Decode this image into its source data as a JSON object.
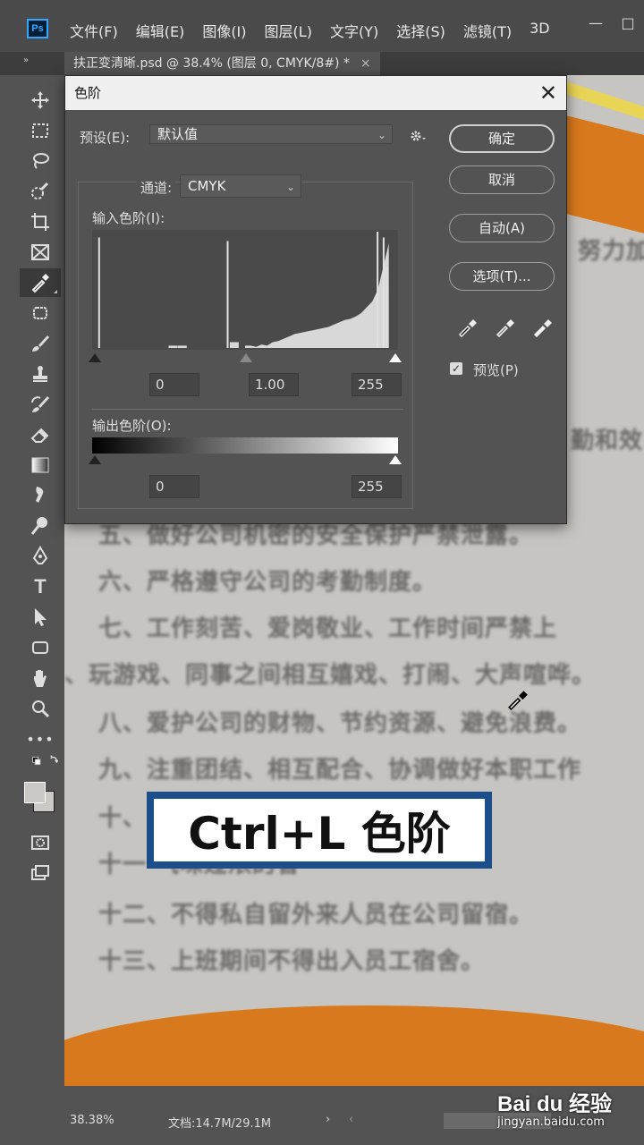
{
  "app": {
    "logo": "Ps",
    "menu": [
      "文件(F)",
      "编辑(E)",
      "图像(I)",
      "图层(L)",
      "文字(Y)",
      "选择(S)",
      "滤镜(T)",
      "3D"
    ],
    "window_controls": [
      "—",
      "□"
    ]
  },
  "tab": {
    "title": "扶正变清晰.psd @ 38.4% (图层 0, CMYK/8#) *",
    "close": "×",
    "collapse": "»"
  },
  "toolbar": {
    "tools": [
      "move-tool",
      "marquee-tool",
      "lasso-tool",
      "quick-select-tool",
      "crop-tool",
      "frame-tool",
      "eyedropper-tool",
      "patch-tool",
      "brush-tool",
      "stamp-tool",
      "history-brush-tool",
      "eraser-tool",
      "gradient-tool",
      "smudge-tool",
      "dodge-tool",
      "pen-tool",
      "type-tool",
      "path-select-tool",
      "shape-tool",
      "hand-tool",
      "zoom-tool",
      "more-tools",
      "swap-colors",
      "color-swatches",
      "quick-mask",
      "screen-mode"
    ],
    "more": "•••",
    "type_glyph": "T"
  },
  "dialog": {
    "title": "色阶",
    "close": "✕",
    "preset_label": "预设(E):",
    "preset_value": "默认值",
    "channel_label": "通道:",
    "channel_value": "CMYK",
    "input_label": "输入色阶(I):",
    "input_values": [
      "0",
      "1.00",
      "255"
    ],
    "output_label": "输出色阶(O):",
    "output_values": [
      "0",
      "255"
    ],
    "buttons": {
      "ok": "确定",
      "cancel": "取消",
      "auto": "自动(A)",
      "options": "选项(T)..."
    },
    "preview_label": "预览(P)",
    "preview_checked": true,
    "caret": "⌄"
  },
  "document": {
    "lines": [
      "努力加",
      "勤和效",
      "五、做好公司机密的安全保护严禁泄露。",
      "六、严格遵守公司的考勤制度。",
      "七、工作刻苦、爱岗敬业、工作时间严禁上",
      "、玩游戏、同事之间相互嬉戏、打闹、大声喧哗。",
      "八、爱护公司的财物、节约资源、避免浪费。",
      "九、注重团结、相互配合、协调做好本职工作",
      "十、                            味的食品。",
      "十一                              气味过浓的香",
      "十二、不得私自留外来人员在公司留宿。",
      "十三、上班期间不得出入员工宿舍。"
    ],
    "caption": "Ctrl+L 色阶"
  },
  "status": {
    "zoom": "38.38%",
    "doc": "文档:14.7M/29.1M",
    "arrow": "›",
    "arrow_left": "‹"
  },
  "watermark": {
    "logo": "Bai du 经验",
    "url": "jingyan.baidu.com"
  },
  "colors": {
    "accent_orange": "#d9791e",
    "caption_border": "#1d4e8c",
    "ps_blue": "#31a8ff"
  },
  "histogram": {
    "spikes": [
      {
        "pos": 0.02,
        "h": 0.95
      },
      {
        "pos": 0.44,
        "h": 0.92
      },
      {
        "pos": 0.93,
        "h": 1.0
      },
      {
        "pos": 0.95,
        "h": 0.95
      },
      {
        "pos": 0.96,
        "h": 0.7
      }
    ],
    "ramp": [
      0.02,
      0.02,
      0.01,
      0.03,
      0.02,
      0.05,
      0.06,
      0.08,
      0.1,
      0.12,
      0.13,
      0.14,
      0.15,
      0.16,
      0.17,
      0.18,
      0.2,
      0.22,
      0.24,
      0.25,
      0.27,
      0.3,
      0.35,
      0.4,
      0.5,
      0.7,
      0.9
    ]
  }
}
